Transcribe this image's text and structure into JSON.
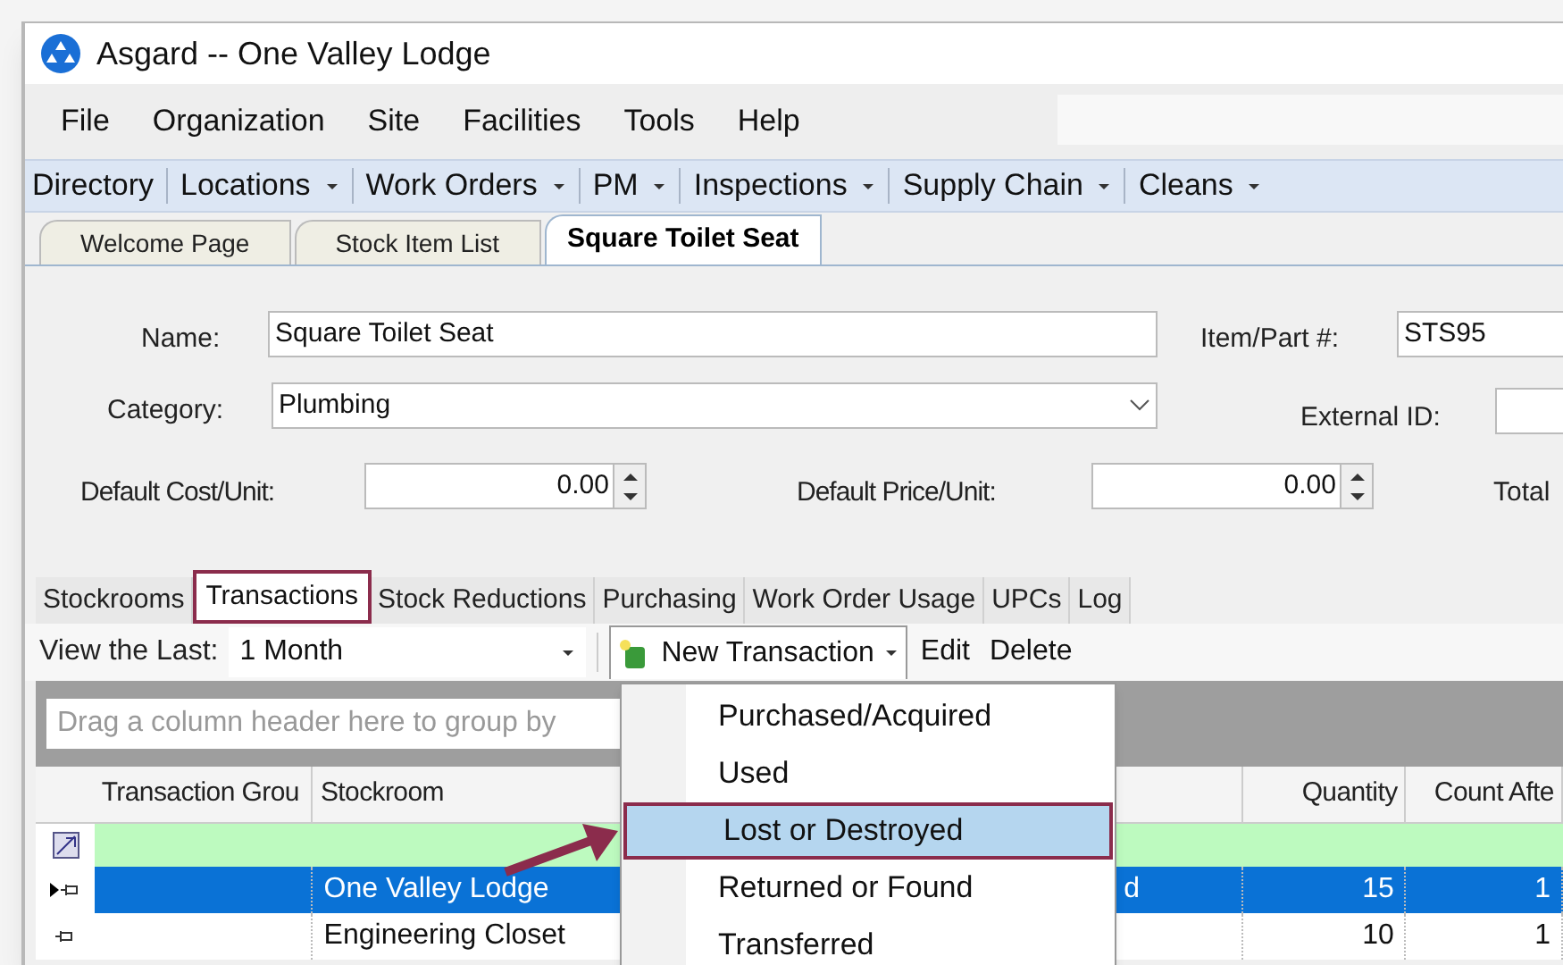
{
  "window": {
    "title": "Asgard -- One Valley Lodge"
  },
  "menu": [
    "File",
    "Organization",
    "Site",
    "Facilities",
    "Tools",
    "Help"
  ],
  "toolbar": [
    {
      "label": "Directory",
      "dropdown": false
    },
    {
      "label": "Locations",
      "dropdown": true
    },
    {
      "label": "Work Orders",
      "dropdown": true
    },
    {
      "label": "PM",
      "dropdown": true
    },
    {
      "label": "Inspections",
      "dropdown": true
    },
    {
      "label": "Supply Chain",
      "dropdown": true
    },
    {
      "label": "Cleans",
      "dropdown": true
    }
  ],
  "doc_tabs": [
    {
      "label": "Welcome Page",
      "selected": false
    },
    {
      "label": "Stock Item List",
      "selected": false
    },
    {
      "label": "Square Toilet Seat",
      "selected": true
    }
  ],
  "form": {
    "name_label": "Name:",
    "name": "Square Toilet Seat",
    "item_label": "Item/Part #:",
    "item": "STS95",
    "category_label": "Category:",
    "category": "Plumbing",
    "external_label": "External ID:",
    "cost_label": "Default Cost/Unit:",
    "cost": "0.00",
    "price_label": "Default Price/Unit:",
    "price": "0.00",
    "total_label": "Total"
  },
  "sub_tabs": [
    {
      "label": "Stockrooms",
      "selected": false
    },
    {
      "label": "Transactions",
      "selected": true
    },
    {
      "label": "Stock Reductions",
      "selected": false
    },
    {
      "label": "Purchasing",
      "selected": false
    },
    {
      "label": "Work Order Usage",
      "selected": false
    },
    {
      "label": "UPCs",
      "selected": false
    },
    {
      "label": "Log",
      "selected": false
    }
  ],
  "grid_toolbar": {
    "view_label": "View the Last:",
    "view_value": "1 Month",
    "new_button": "New Transaction",
    "edit": "Edit",
    "delete": "Delete"
  },
  "group_panel": {
    "placeholder": "Drag a column header here to group by"
  },
  "table": {
    "columns": [
      "Transaction Grou",
      "Stockroom",
      "Quantity",
      "Count Afte"
    ],
    "rows": [
      {
        "stockroom": "One Valley Lodge",
        "column_3": "d",
        "quantity": "15",
        "count_after": "1",
        "selected": true
      },
      {
        "stockroom": "Engineering Closet",
        "quantity": "10",
        "count_after": "1",
        "selected": false
      }
    ]
  },
  "dropdown_menu": [
    {
      "label": "Purchased/Acquired",
      "selected": false
    },
    {
      "label": "Used",
      "selected": false
    },
    {
      "label": "Lost or Destroyed",
      "selected": true
    },
    {
      "label": "Returned or Found",
      "selected": false
    },
    {
      "label": "Transferred",
      "selected": false
    }
  ]
}
